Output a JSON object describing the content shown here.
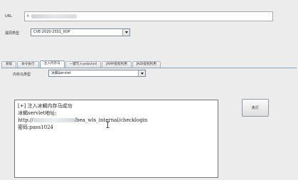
{
  "form": {
    "url_label": "URL",
    "url_value": "h",
    "vuln_type_label": "漏洞类型",
    "vuln_type_value": "CVE-2020-2551_IIOP"
  },
  "tabs": [
    {
      "label": "获取"
    },
    {
      "label": "命令执行"
    },
    {
      "label": "注入内存马",
      "active": true
    },
    {
      "label": "一键写入webshell"
    },
    {
      "label": "JRMP提权利用"
    },
    {
      "label": "JNDI提权利用"
    }
  ],
  "memshell": {
    "type_label": "内存马类型",
    "type_value": "冰蝎$ervlet",
    "execute_label": "执行"
  },
  "output": {
    "line1": "[+] 注入冰蝎内存马成功",
    "line2": "冰蝎servlet地址:",
    "line3_prefix": "http://",
    "line3_suffix": "/bea_wls_internal/checklogin",
    "line4": "密码:pass1024"
  },
  "colors": {
    "background": "#ececec",
    "accent_border": "#8aa0b8"
  }
}
